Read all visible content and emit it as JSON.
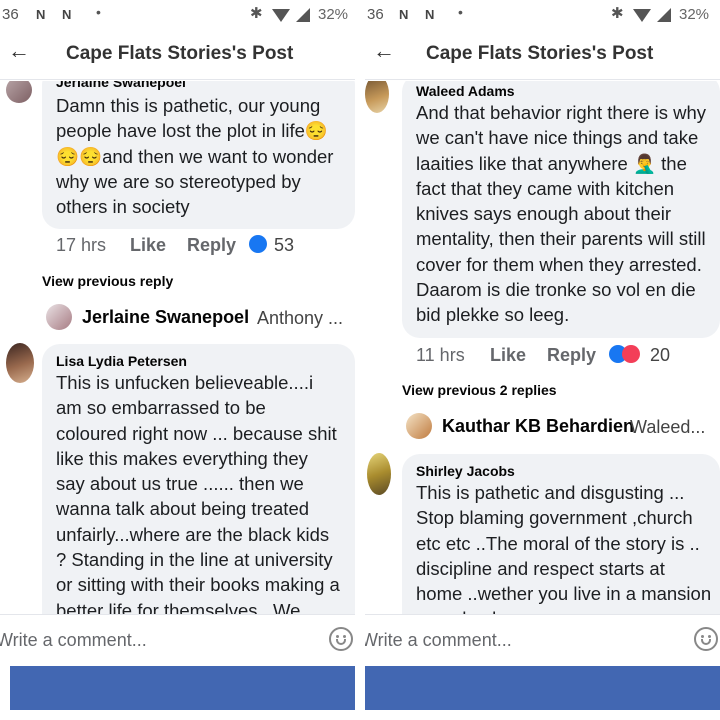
{
  "left": {
    "status": {
      "time": "36",
      "battery": "32%"
    },
    "header": {
      "back_icon": "←",
      "title": "Cape Flats Stories's Post"
    },
    "comment1": {
      "author_partial": "Jerlaine Swanepoel",
      "text": "Damn this is pathetic, our young people have lost the plot in life😔😔😔and then we want to wonder why we are so stereotyped by others in society",
      "time": "17 hrs",
      "like": "Like",
      "reply": "Reply",
      "reaction_count": "53"
    },
    "view_previous": "View previous reply",
    "reply_preview": {
      "name": "Jerlaine Swanepoel",
      "preview": "Anthony ..."
    },
    "comment2": {
      "author": "Lisa Lydia Petersen",
      "text": "This is unfucken believeable....i am so embarrassed to be coloured right now ... because shit like this makes everything they say about us true ...... then we wanna talk about being treated unfairly...where are the black kids ? Standing in the line at university or sitting with their books making a better life for themselves...We certainly at the"
    },
    "composer": {
      "placeholder": "Write a comment..."
    }
  },
  "right": {
    "status": {
      "time": "36",
      "battery": "32%"
    },
    "header": {
      "back_icon": "←",
      "title": "Cape Flats Stories's Post"
    },
    "comment1": {
      "author": "Waleed Adams",
      "text": "And that behavior right there is why we can't have nice things and take laaities like that anywhere 🤦‍♂️ the fact that they came with kitchen knives says enough about their mentality, then their parents will still cover for them when they arrested. Daarom is die tronke so vol en die bid plekke so leeg.",
      "time": "11 hrs",
      "like": "Like",
      "reply": "Reply",
      "reaction_count": "20"
    },
    "view_previous": "View previous 2 replies",
    "reply_preview": {
      "name": "Kauthar KB Behardien",
      "preview": "Waleed..."
    },
    "comment2": {
      "author": "Shirley Jacobs",
      "text": "This is pathetic and disgusting ... Stop blaming government ,church etc etc ..The moral of the story is .. discipline and respect starts at home ..wether you live in a mansion or a shack..."
    },
    "composer": {
      "placeholder": "Write a comment..."
    }
  },
  "colors": {
    "bubble": "#f0f2f5",
    "like_blue": "#1877f2",
    "love_red": "#f33e58",
    "bottom_bar": "#4267b2"
  },
  "icons": [
    "back-arrow-icon",
    "like-reaction-icon",
    "love-reaction-icon",
    "emoji-icon",
    "bluetooth-icon",
    "wifi-icon",
    "signal-icon"
  ]
}
